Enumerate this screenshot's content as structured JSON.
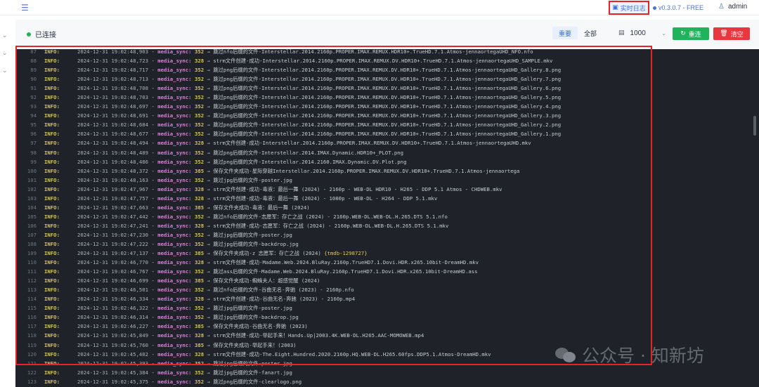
{
  "topbar": {
    "realtime_log_label": "实时日志",
    "version_label": "v0.3.0.7 - FREE",
    "user_label": "admin"
  },
  "toolbar": {
    "status_label": "已连接",
    "filter_options": [
      "重要",
      "全部"
    ],
    "selected_filter": "重要",
    "line_count": "1000",
    "reconnect_label": "重连",
    "clear_label": "清空"
  },
  "colors": {
    "accent": "#3b6fd8",
    "connected": "#23b25a",
    "reconnect": "#1fb45c",
    "clear": "#e8373e",
    "log_bg": "#1f2329",
    "highlight": "#e62424"
  },
  "icons": {
    "menu": "menu-icon",
    "realtime_log": "log-icon",
    "user": "user-icon",
    "lines": "list-icon",
    "reconnect": "refresh-icon",
    "clear": "trash-icon"
  },
  "watermark": "公众号 · 知新坊",
  "log_rows": [
    {
      "n": "87",
      "lvl": "INFO:",
      "ts": "2024-12-31 19:02:48,903",
      "mod": "media_sync:",
      "line": "352",
      "msg": "跳过nfo后缀的文件-Interstellar.2014.2160p.PROPER.IMAX.REMUX.HDR10+.TrueHD.7.1.Atmos-jennaortegaUHD_NFO.nfo"
    },
    {
      "n": "88",
      "lvl": "INFO:",
      "ts": "2024-12-31 19:02:48,723",
      "mod": "media_sync:",
      "line": "328",
      "msg": "strm文件创建-成功-Interstellar.2014.2160p.PROPER.IMAX.REMUX.DV.HDR10+.TrueHD.7.1.Atmos-jennaortegaUHD_SAMPLE.mkv"
    },
    {
      "n": "89",
      "lvl": "INFO:",
      "ts": "2024-12-31 19:02:48,717",
      "mod": "media_sync:",
      "line": "352",
      "msg": "跳过png后缀的文件-Interstellar.2014.2160p.PROPER.IMAX.REMUX.DV.HDR10+.TrueHD.7.1.Atmos-jennaortegaUHD_Gallery.8.png"
    },
    {
      "n": "90",
      "lvl": "INFO:",
      "ts": "2024-12-31 19:02:48,713",
      "mod": "media_sync:",
      "line": "352",
      "msg": "跳过png后缀的文件-Interstellar.2014.2160p.PROPER.IMAX.REMUX.DV.HDR10+.TrueHD.7.1.Atmos-jennaortegaUHD_Gallery.7.png"
    },
    {
      "n": "91",
      "lvl": "INFO:",
      "ts": "2024-12-31 19:02:48,708",
      "mod": "media_sync:",
      "line": "352",
      "msg": "跳过png后缀的文件-Interstellar.2014.2160p.PROPER.IMAX.REMUX.DV.HDR10+.TrueHD.7.1.Atmos-jennaortegaUHD_Gallery.6.png"
    },
    {
      "n": "92",
      "lvl": "INFO:",
      "ts": "2024-12-31 19:02:48,703",
      "mod": "media_sync:",
      "line": "352",
      "msg": "跳过png后缀的文件-Interstellar.2014.2160p.PROPER.IMAX.REMUX.DV.HDR10+.TrueHD.7.1.Atmos-jennaortegaUHD_Gallery.5.png"
    },
    {
      "n": "93",
      "lvl": "INFO:",
      "ts": "2024-12-31 19:02:48,697",
      "mod": "media_sync:",
      "line": "352",
      "msg": "跳过png后缀的文件-Interstellar.2014.2160p.PROPER.IMAX.REMUX.DV.HDR10+.TrueHD.7.1.Atmos-jennaortegaUHD_Gallery.4.png"
    },
    {
      "n": "94",
      "lvl": "INFO:",
      "ts": "2024-12-31 19:02:48,691",
      "mod": "media_sync:",
      "line": "352",
      "msg": "跳过png后缀的文件-Interstellar.2014.2160p.PROPER.IMAX.REMUX.DV.HDR10+.TrueHD.7.1.Atmos-jennaortegaUHD_Gallery.3.png"
    },
    {
      "n": "95",
      "lvl": "INFO:",
      "ts": "2024-12-31 19:02:48,684",
      "mod": "media_sync:",
      "line": "352",
      "msg": "跳过png后缀的文件-Interstellar.2014.2160p.PROPER.IMAX.REMUX.DV.HDR10+.TrueHD.7.1.Atmos-jennaortegaUHD_Gallery.2.png"
    },
    {
      "n": "96",
      "lvl": "INFO:",
      "ts": "2024-12-31 19:02:48,677",
      "mod": "media_sync:",
      "line": "352",
      "msg": "跳过png后缀的文件-Interstellar.2014.2160p.PROPER.IMAX.REMUX.DV.HDR10+.TrueHD.7.1.Atmos-jennaortegaUHD_Gallery.1.png"
    },
    {
      "n": "97",
      "lvl": "INFO:",
      "ts": "2024-12-31 19:02:48,494",
      "mod": "media_sync:",
      "line": "328",
      "msg": "strm文件创建-成功-Interstellar.2014.2160p.PROPER.IMAX.REMUX.DV.HDR10+.TrueHD.7.1.Atmos-jennaortegaUHD.mkv"
    },
    {
      "n": "98",
      "lvl": "INFO:",
      "ts": "2024-12-31 19:02:48,489",
      "mod": "media_sync:",
      "line": "352",
      "msg": "跳过png后缀的文件-Interstellar.2014.IMAX.Dynamic.HDR10+_PLOT.png"
    },
    {
      "n": "99",
      "lvl": "INFO:",
      "ts": "2024-12-31 19:02:48,486",
      "mod": "media_sync:",
      "line": "352",
      "msg": "跳过png后缀的文件-Interstellar.2014.2160.IMAX.Dynamic.DV.Plot.png"
    },
    {
      "n": "100",
      "lvl": "INFO:",
      "ts": "2024-12-31 19:02:48,372",
      "mod": "media_sync:",
      "line": "385",
      "msg": "保存文件夹成功-星际穿越Interstellar.2014.2160p.PROPER.IMAX.REMUX.DV.HDR10+.TrueHD.7.1.Atmos-jennaortega"
    },
    {
      "n": "101",
      "lvl": "INFO:",
      "ts": "2024-12-31 19:02:48,163",
      "mod": "media_sync:",
      "line": "352",
      "msg": "跳过jpg后缀的文件-poster.jpg"
    },
    {
      "n": "102",
      "lvl": "INFO:",
      "ts": "2024-12-31 19:02:47,967",
      "mod": "media_sync:",
      "line": "328",
      "msg": "strm文件创建-成功-毒液：最后一舞 (2024) - 2160p - WEB-DL HDR10 - H265 - DDP 5.1 Atmos - CHDWEB.mkv"
    },
    {
      "n": "103",
      "lvl": "INFO:",
      "ts": "2024-12-31 19:02:47,757",
      "mod": "media_sync:",
      "line": "328",
      "msg": "strm文件创建-成功-毒液：最后一舞 (2024) - 1080p - WEB-DL - H264 - DDP 5.1.mkv"
    },
    {
      "n": "104",
      "lvl": "INFO:",
      "ts": "2024-12-31 19:02:47,663",
      "mod": "media_sync:",
      "line": "385",
      "msg": "保存文件夹成功-毒液：最后一舞 (2024)"
    },
    {
      "n": "105",
      "lvl": "INFO:",
      "ts": "2024-12-31 19:02:47,442",
      "mod": "media_sync:",
      "line": "352",
      "msg": "跳过nfo后缀的文件-志愿军：存亡之战 (2024) - 2160p.WEB-DL.WEB-DL.H.265.DTS 5.1.nfo"
    },
    {
      "n": "106",
      "lvl": "INFO:",
      "ts": "2024-12-31 19:02:47,241",
      "mod": "media_sync:",
      "line": "328",
      "msg": "strm文件创建-成功-志愿军：存亡之战 (2024) - 2160p.WEB-DL.WEB-DL.H.265.DTS 5.1.mkv"
    },
    {
      "n": "107",
      "lvl": "INFO:",
      "ts": "2024-12-31 19:02:47,230",
      "mod": "media_sync:",
      "line": "352",
      "msg": "跳过jpg后缀的文件-poster.jpg"
    },
    {
      "n": "108",
      "lvl": "INFO:",
      "ts": "2024-12-31 19:02:47,222",
      "mod": "media_sync:",
      "line": "352",
      "msg": "跳过jpg后缀的文件-backdrop.jpg"
    },
    {
      "n": "109",
      "lvl": "INFO:",
      "ts": "2024-12-31 19:02:47,137",
      "mod": "media_sync:",
      "line": "385",
      "msg": "保存文件夹成功-z 志愿军：存亡之战 (2024) ",
      "tag": "{tmdb-1298727}"
    },
    {
      "n": "110",
      "lvl": "INFO:",
      "ts": "2024-12-31 19:02:46,770",
      "mod": "media_sync:",
      "line": "328",
      "msg": "strm文件创建-成功-Madame.Web.2024.BluRay.2160p.TrueHD7.1.Dovi.HDR.x265.10bit-DreamHD.mkv"
    },
    {
      "n": "111",
      "lvl": "INFO:",
      "ts": "2024-12-31 19:02:46,767",
      "mod": "media_sync:",
      "line": "352",
      "msg": "跳过ass后缀的文件-Madame.Web.2024.BluRay.2160p.TrueHD7.1.Dovi.HDR.x265.10bit-DreamHD.ass"
    },
    {
      "n": "112",
      "lvl": "INFO:",
      "ts": "2024-12-31 19:02:46,699",
      "mod": "media_sync:",
      "line": "385",
      "msg": "保存文件夹成功-蜘蛛夫人：超感觉醒 (2024)"
    },
    {
      "n": "113",
      "lvl": "INFO:",
      "ts": "2024-12-31 19:02:46,501",
      "mod": "media_sync:",
      "line": "352",
      "msg": "跳过nfo后缀的文件-谷曲无名-奔驰 (2023) - 2160p.nfo"
    },
    {
      "n": "114",
      "lvl": "INFO:",
      "ts": "2024-12-31 19:02:46,334",
      "mod": "media_sync:",
      "line": "328",
      "msg": "strm文件创建-成功-谷曲无名-奔驰 (2023) - 2160p.mp4"
    },
    {
      "n": "115",
      "lvl": "INFO:",
      "ts": "2024-12-31 19:02:46,322",
      "mod": "media_sync:",
      "line": "352",
      "msg": "跳过jpg后缀的文件-poster.jpg"
    },
    {
      "n": "116",
      "lvl": "INFO:",
      "ts": "2024-12-31 19:02:46,314",
      "mod": "media_sync:",
      "line": "352",
      "msg": "跳过jpg后缀的文件-backdrop.jpg"
    },
    {
      "n": "117",
      "lvl": "INFO:",
      "ts": "2024-12-31 19:02:46,227",
      "mod": "media_sync:",
      "line": "385",
      "msg": "保存文件夹成功-谷曲无名-奔驰 (2023)"
    },
    {
      "n": "118",
      "lvl": "INFO:",
      "ts": "2024-12-31 19:02:45,849",
      "mod": "media_sync:",
      "line": "328",
      "msg": "strm文件创建-成功-举起手来！Hands.Up|2003.4K.WEB-DL.H265.AAC-MOMOWEB.mp4"
    },
    {
      "n": "119",
      "lvl": "INFO:",
      "ts": "2024-12-31 19:02:45,760",
      "mod": "media_sync:",
      "line": "385",
      "msg": "保存文件夹成功-举起手来！(2003)"
    },
    {
      "n": "120",
      "lvl": "INFO:",
      "ts": "2024-12-31 19:02:45,402",
      "mod": "media_sync:",
      "line": "328",
      "msg": "strm文件创建-成功-The.Eight.Hundred.2020.2160p.HQ.WEB-DL.H265.60fps.DDP5.1.Atmos-DreamHD.mkv"
    },
    {
      "n": "121",
      "lvl": "INFO:",
      "ts": "2024-12-31 19:02:45,393",
      "mod": "media_sync:",
      "line": "352",
      "msg": "跳过jpg后缀的文件-poster.jpg"
    },
    {
      "n": "122",
      "lvl": "INFO:",
      "ts": "2024-12-31 19:02:45,384",
      "mod": "media_sync:",
      "line": "352",
      "msg": "跳过jpg后缀的文件-fanart.jpg"
    },
    {
      "n": "123",
      "lvl": "INFO:",
      "ts": "2024-12-31 19:02:45,375",
      "mod": "media_sync:",
      "line": "352",
      "msg": "跳过png后缀的文件-clearlogo.png"
    }
  ]
}
